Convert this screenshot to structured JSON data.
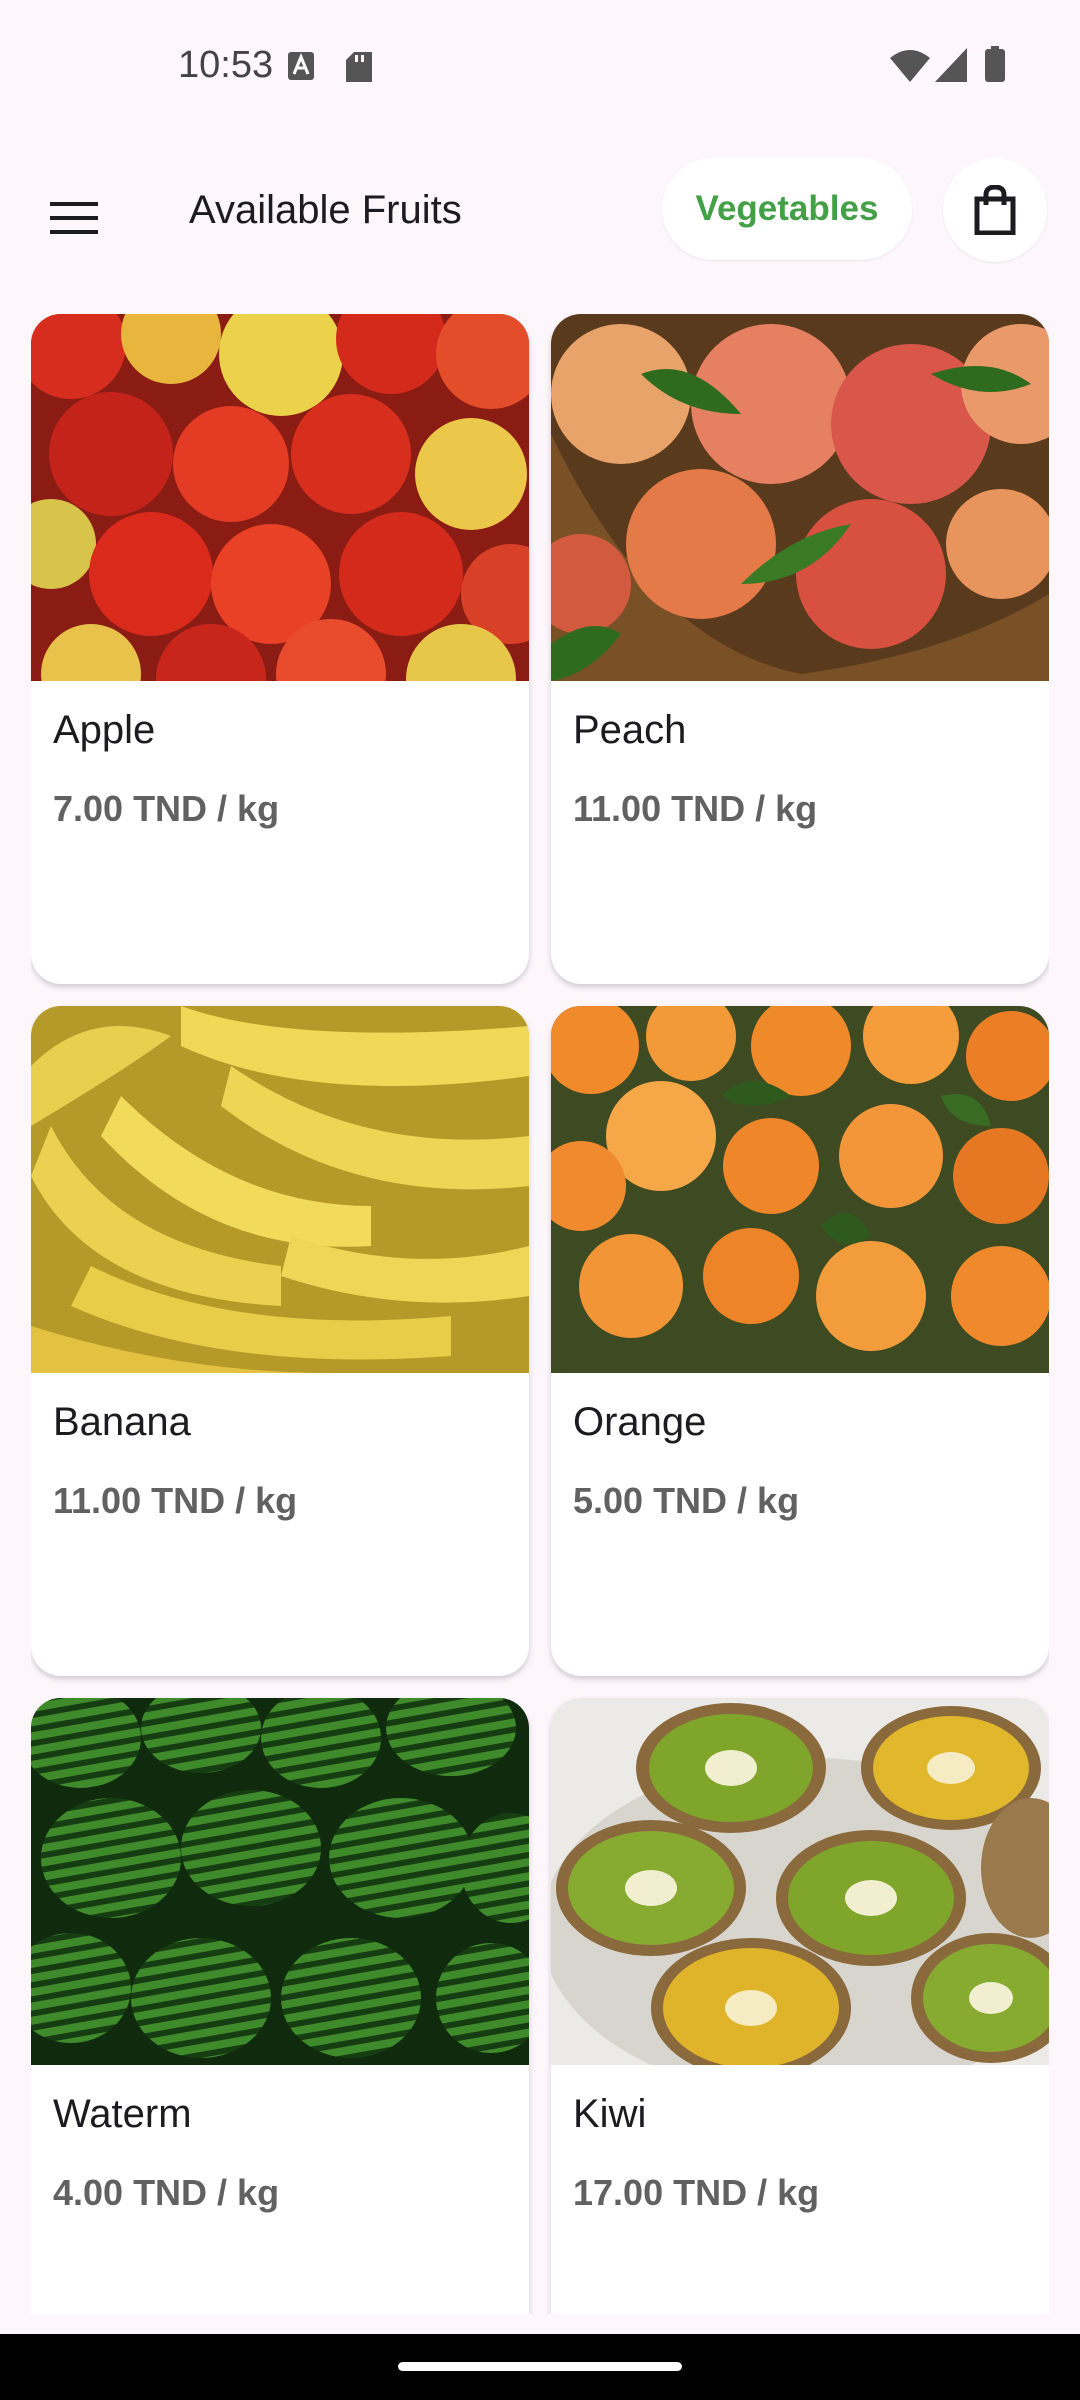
{
  "status_bar": {
    "time": "10:53",
    "icons_left": [
      "a-badge-icon",
      "sd-card-icon"
    ],
    "icons_right": [
      "wifi-icon",
      "signal-icon",
      "battery-icon"
    ]
  },
  "app_bar": {
    "menu_icon": "hamburger-menu-icon",
    "title": "Available Fruits",
    "vegetables_button": "Vegetables",
    "cart_icon": "shopping-bag-icon",
    "accent_color": "#43a047"
  },
  "products": [
    {
      "name": "Apple",
      "price": "7.00 TND / kg"
    },
    {
      "name": "Peach",
      "price": "11.00 TND / kg"
    },
    {
      "name": "Banana",
      "price": "11.00 TND / kg"
    },
    {
      "name": "Orange",
      "price": "5.00 TND / kg"
    },
    {
      "name": "Waterm",
      "price": "4.00 TND / kg"
    },
    {
      "name": "Kiwi",
      "price": "17.00 TND / kg"
    }
  ]
}
